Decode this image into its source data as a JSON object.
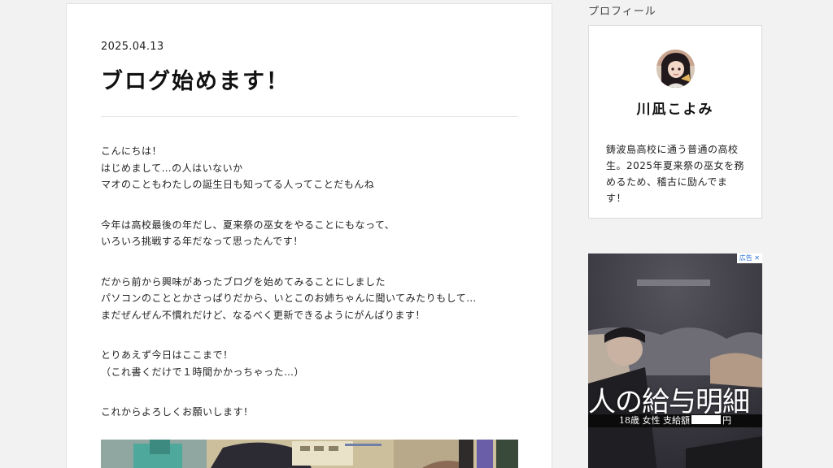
{
  "article": {
    "date": "2025.04.13",
    "title": "ブログ始めます！",
    "paragraphs": [
      [
        "こんにちは！",
        "はじめまして…の人はいないか",
        "マオのこともわたしの誕生日も知ってる人ってことだもんね"
      ],
      [
        "今年は高校最後の年だし、夏来祭の巫女をやることにもなって、",
        "いろいろ挑戦する年だなって思ったんです！"
      ],
      [
        "だから前から興味があったブログを始めてみることにしました",
        "パソコンのこととかさっぱりだから、いとこのお姉ちゃんに聞いてみたりもして…",
        "まだぜんぜん不慣れだけど、なるべく更新できるようにがんばります！"
      ],
      [
        "とりあえず今日はここまで！",
        "（これ書くだけで１時間かかっちゃった…）"
      ],
      [
        "これからよろしくお願いします！"
      ]
    ]
  },
  "sidebar": {
    "heading": "プロフィール",
    "profile": {
      "name": "川凪こよみ",
      "bio": "鋳波島高校に通う普通の高校生。2025年夏来祭の巫女を務めるため、稽古に励んでます！"
    },
    "ad": {
      "badge": "広告 ✕",
      "headline": "人の給与明細",
      "sub_prefix": "18歳 女性 支給額",
      "sub_suffix": "円"
    }
  },
  "colors": {
    "background": "#f2f2f2",
    "card": "#ffffff",
    "text": "#222222",
    "ad_badge": "#2a6fd6"
  }
}
